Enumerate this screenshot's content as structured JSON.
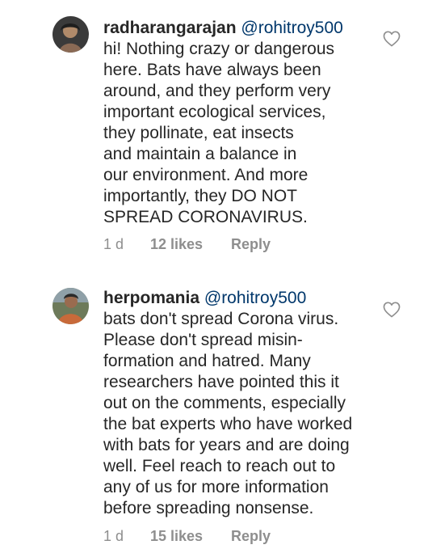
{
  "comments": [
    {
      "username": "radharangarajan",
      "mention": "@rohitroy500",
      "lines": [
        "hi! Nothing crazy or dangerous",
        "here. Bats have always been",
        "around, and they perform very",
        "important ecological services,",
        "they pollinate, eat insects",
        "and maintain a balance in",
        "our environment. And more",
        "importantly, they DO NOT",
        "SPREAD CORONAVIRUS."
      ],
      "time": "1 d",
      "likes": "12 likes",
      "reply": "Reply",
      "icons": {
        "avatar": "user-avatar",
        "like": "heart-icon"
      }
    },
    {
      "username": "herpomania",
      "mention": "@rohitroy500",
      "lines": [
        "bats don't spread Corona virus.",
        "Please don't spread misin-",
        "formation and hatred. Many",
        "researchers have pointed this it",
        "out on the comments, especially",
        "the bat experts who have worked",
        "with bats for years and are doing",
        "well. Feel reach to reach out to",
        "any of us for more information",
        "before spreading nonsense."
      ],
      "time": "1 d",
      "likes": "15 likes",
      "reply": "Reply",
      "icons": {
        "avatar": "user-avatar",
        "like": "heart-icon"
      }
    }
  ],
  "colors": {
    "text": "#262626",
    "mention": "#00376b",
    "secondary": "#8e8e8e",
    "background": "#ffffff"
  }
}
